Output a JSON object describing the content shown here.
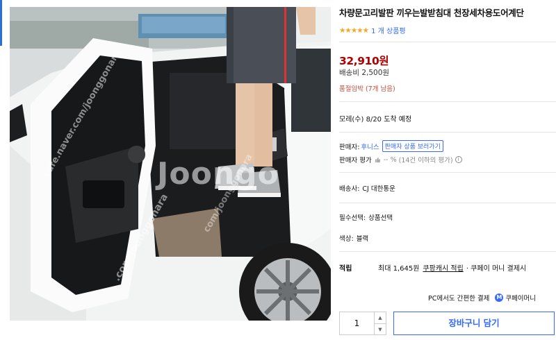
{
  "product": {
    "title": "차량문고리발판 끼우는발받침대 천장세차용도어계단",
    "stars": "★★★★★",
    "review_count": "1 개 상품평",
    "rating": 5,
    "price": "32,910원",
    "shipping": "배송비 2,500원",
    "stock_notice": "품절임박 (7개 남음)",
    "delivery": "모레(수) 8/20 도착 예정"
  },
  "seller": {
    "label": "판매자:",
    "name": "후니스",
    "button": "판매자 상품 보러가기",
    "rating_label": "판매자 평가",
    "rating_value": "-- %",
    "rating_note": "(14건 이하의 평가)"
  },
  "courier": {
    "label": "배송사:",
    "value": "CJ 대한통운"
  },
  "required_option": {
    "label": "필수선택:",
    "value": "상품선택"
  },
  "color": {
    "label": "색상:",
    "value": "블랙"
  },
  "points": {
    "label": "적립",
    "max": "최대 1,645원",
    "link": "쿠팡캐시 적립",
    "suffix": "· 쿠페이 머니 결제시"
  },
  "pc_payment": {
    "text": "PC에서도 간편한 결제",
    "brand": "쿠페이머니",
    "badge": "M"
  },
  "quantity": {
    "value": "1",
    "up": "▲",
    "down": "▼"
  },
  "cart_button": "장바구니 담기",
  "image": {
    "watermark_main": "Joongo",
    "watermark_1": "cafe.naver.com/joonggonara",
    "watermark_2": ".com/joonggonara",
    "watermark_3": "com/joonggonara"
  },
  "colors": {
    "accent": "#346aff",
    "price": "#ae0000",
    "star": "#f5a623",
    "notice": "#c04a3a"
  }
}
